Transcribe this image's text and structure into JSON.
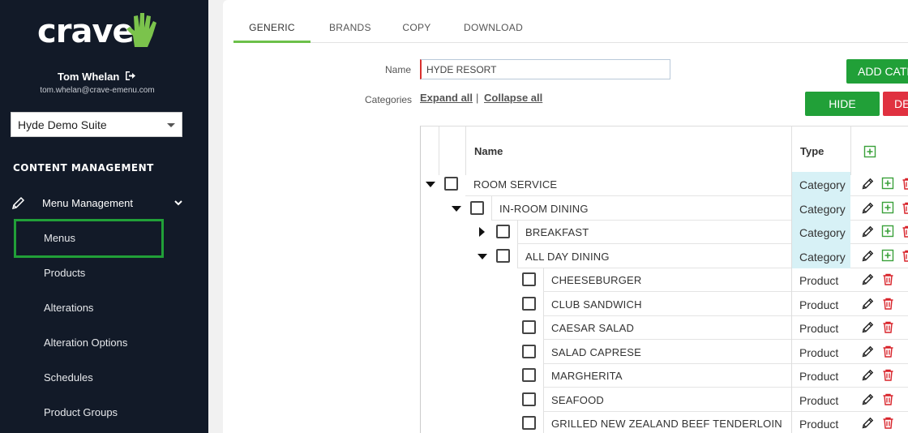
{
  "sidebar": {
    "logo_text": "crave",
    "user_name": "Tom Whelan",
    "user_email": "tom.whelan@crave-emenu.com",
    "suite": "Hyde Demo Suite",
    "section_title": "CONTENT MANAGEMENT",
    "menu_management": "Menu Management",
    "items": [
      "Menus",
      "Products",
      "Alterations",
      "Alteration Options",
      "Schedules",
      "Product Groups"
    ],
    "accent_color": "#21a038"
  },
  "tabs": [
    "GENERIC",
    "BRANDS",
    "COPY",
    "DOWNLOAD"
  ],
  "form": {
    "name_label": "Name",
    "name_value": "HYDE RESORT",
    "categories_label": "Categories",
    "expand_all": "Expand all",
    "separator": "|",
    "collapse_all": "Collapse all"
  },
  "buttons": {
    "add_category": "ADD CATE",
    "hide": "HIDE",
    "delete": "DE"
  },
  "table": {
    "headers": {
      "name": "Name",
      "type": "Type"
    },
    "rows": [
      {
        "name": "ROOM SERVICE",
        "type": "Category",
        "level": 0,
        "toggle": "expanded"
      },
      {
        "name": "IN-ROOM DINING",
        "type": "Category",
        "level": 1,
        "toggle": "expanded"
      },
      {
        "name": "BREAKFAST",
        "type": "Category",
        "level": 2,
        "toggle": "collapsed"
      },
      {
        "name": "ALL DAY DINING",
        "type": "Category",
        "level": 2,
        "toggle": "expanded"
      },
      {
        "name": "CHEESEBURGER",
        "type": "Product",
        "level": 3
      },
      {
        "name": "CLUB SANDWICH",
        "type": "Product",
        "level": 3
      },
      {
        "name": "CAESAR SALAD",
        "type": "Product",
        "level": 3
      },
      {
        "name": "SALAD CAPRESE",
        "type": "Product",
        "level": 3
      },
      {
        "name": "MARGHERITA",
        "type": "Product",
        "level": 3
      },
      {
        "name": "SEAFOOD",
        "type": "Product",
        "level": 3
      },
      {
        "name": "GRILLED NEW ZEALAND BEEF TENDERLOIN",
        "type": "Product",
        "level": 3
      }
    ]
  },
  "colors": {
    "sidebar_bg": "#121a28",
    "green": "#21a038",
    "red": "#e03140",
    "category_bg": "#d7f1f6"
  }
}
